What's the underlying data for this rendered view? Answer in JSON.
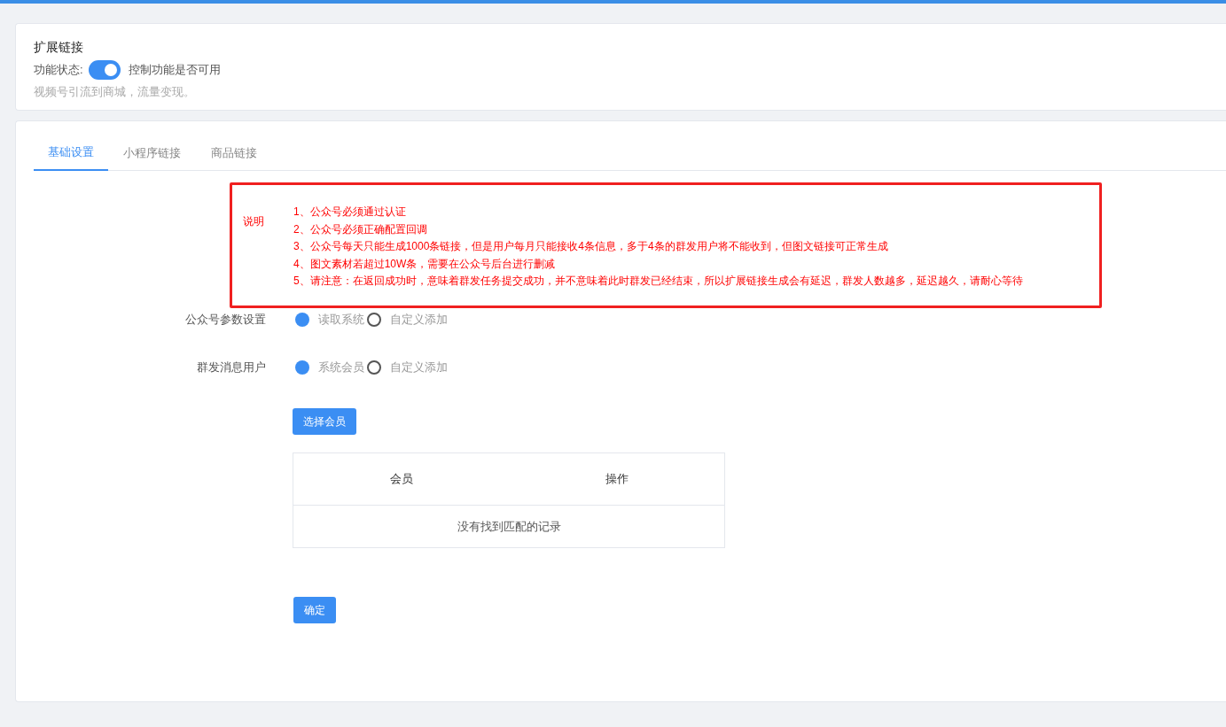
{
  "header": {
    "title": "扩展链接",
    "status_label": "功能状态:",
    "status_on": true,
    "status_hint": "控制功能是否可用",
    "description": "视频号引流到商城，流量变现。"
  },
  "tabs": [
    {
      "label": "基础设置",
      "selected": true
    },
    {
      "label": "小程序链接",
      "selected": false
    },
    {
      "label": "商品链接",
      "selected": false
    }
  ],
  "notice": {
    "label": "说明",
    "lines": [
      "1、公众号必须通过认证",
      "2、公众号必须正确配置回调",
      "3、公众号每天只能生成1000条链接，但是用户每月只能接收4条信息，多于4条的群发用户将不能收到，但图文链接可正常生成",
      "4、图文素材若超过10W条，需要在公众号后台进行删减",
      "5、请注意：在返回成功时，意味着群发任务提交成功，并不意味着此时群发已经结束，所以扩展链接生成会有延迟，群发人数越多，延迟越久，请耐心等待"
    ]
  },
  "fields": [
    {
      "label": "公众号参数设置",
      "options": [
        {
          "label": "读取系统",
          "selected": true
        },
        {
          "label": "自定义添加",
          "selected": false
        }
      ]
    },
    {
      "label": "群发消息用户",
      "options": [
        {
          "label": "系统会员",
          "selected": true
        },
        {
          "label": "自定义添加",
          "selected": false
        }
      ]
    }
  ],
  "select_button": "选择会员",
  "table": {
    "columns": [
      "会员",
      "操作"
    ],
    "empty_text": "没有找到匹配的记录"
  },
  "submit_button": "确定"
}
